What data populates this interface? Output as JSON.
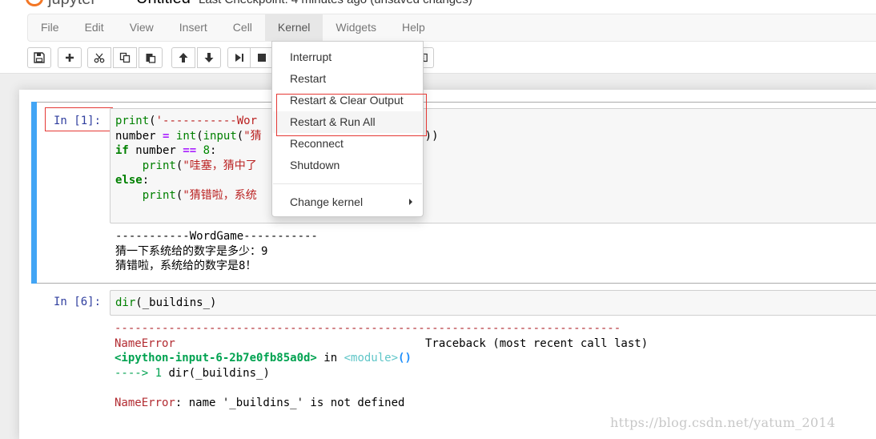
{
  "header": {
    "logo_text": "jupyter",
    "notebook_title": "Untitled",
    "checkpoint": "Last Checkpoint: 4 minutes ago (unsaved changes)"
  },
  "menubar": {
    "items": [
      "File",
      "Edit",
      "View",
      "Insert",
      "Cell",
      "Kernel",
      "Widgets",
      "Help"
    ],
    "active": "Kernel"
  },
  "toolbar": {
    "buttons": [
      "save-icon",
      "plus-icon",
      "cut-icon",
      "copy-icon",
      "paste-icon",
      "arrow-up-icon",
      "arrow-down-icon",
      "step-forward-icon",
      "stop-icon"
    ]
  },
  "kernel_menu": {
    "items": [
      "Interrupt",
      "Restart",
      "Restart & Clear Output",
      "Restart & Run All",
      "Reconnect",
      "Shutdown"
    ],
    "change_kernel": "Change kernel"
  },
  "cells": [
    {
      "prompt": "In [1]:",
      "code": {
        "l1a": "print",
        "l1b": "(",
        "l1c": "'-----------Wor",
        "l2a": "number ",
        "l2b": "=",
        "l2c": " ",
        "l2d": "int",
        "l2e": "(",
        "l2f": "input",
        "l2g": "(",
        "l2h": "\"猜",
        "l2i": "))",
        "l3a": "if",
        "l3b": " number ",
        "l3c": "==",
        "l3d": " ",
        "l3e": "8",
        "l3f": ":",
        "l4a": "    ",
        "l4b": "print",
        "l4c": "(",
        "l4d": "\"哇塞，猜中了",
        "l5a": "else",
        "l5b": ":",
        "l6a": "    ",
        "l6b": "print",
        "l6c": "(",
        "l6d": "\"猜错啦，系统"
      },
      "output": [
        "-----------WordGame-----------",
        "猜一下系统给的数字是多少：9",
        "猜错啦，系统给的数字是8！"
      ]
    },
    {
      "prompt": "In [6]:",
      "code": {
        "a": "dir",
        "b": "(",
        "c": "_buildins_",
        "d": ")"
      },
      "error": {
        "rule": "---------------------------------------------------------------------------",
        "name": "NameError",
        "traceback_label": "Traceback (most recent call last)",
        "input_ref": "<ipython-input-6-2b7e0fb85a0d>",
        "in_word": " in ",
        "module": "<module>",
        "parens": "()",
        "arrow": "----> 1 ",
        "arrow_code": "dir(_buildins_)",
        "final_name": "NameError",
        "final_msg": ": name '_buildins_' is not defined"
      }
    }
  ],
  "watermark": "https://blog.csdn.net/yatum_2014"
}
